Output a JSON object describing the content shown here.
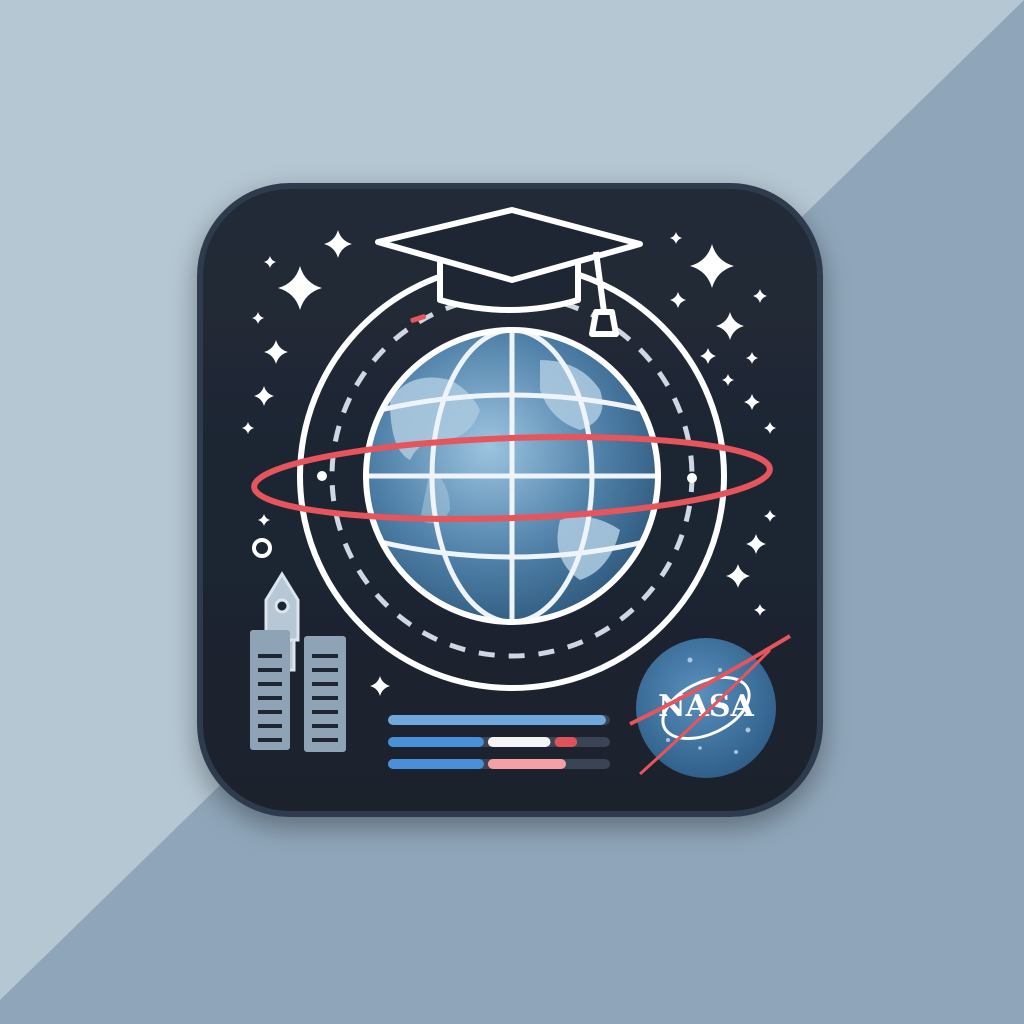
{
  "app_icon": {
    "logo_text": "NASA",
    "theme": "space-education",
    "icons": [
      "graduation-cap-icon",
      "globe-icon",
      "orbit-ring-icon",
      "rocket-icon",
      "launch-tower-icon",
      "nasa-badge-icon",
      "star-icon",
      "progress-bars"
    ],
    "progress_bars": [
      {
        "segments": [
          {
            "color": "#6fa8dc",
            "fraction": 1.0
          }
        ]
      },
      {
        "segments": [
          {
            "color": "#4a90d9",
            "fraction": 0.45
          },
          {
            "color": "#f4f4f4",
            "fraction": 0.3
          },
          {
            "color": "#e0525a",
            "fraction": 0.12
          }
        ]
      },
      {
        "segments": [
          {
            "color": "#4a90d9",
            "fraction": 0.45
          },
          {
            "color": "#f4a0a4",
            "fraction": 0.37
          }
        ]
      }
    ]
  },
  "colors": {
    "background_light": "#b5c7d3",
    "background_dark": "#8fa6ba",
    "tile": "#1e2633",
    "tile_border": "#2d3a4d",
    "line_white": "#ffffff",
    "accent_red": "#e6545c",
    "globe_ocean": "#6b9ac0",
    "globe_land": "#a9c8de",
    "badge_blue": "#3e6f99"
  }
}
